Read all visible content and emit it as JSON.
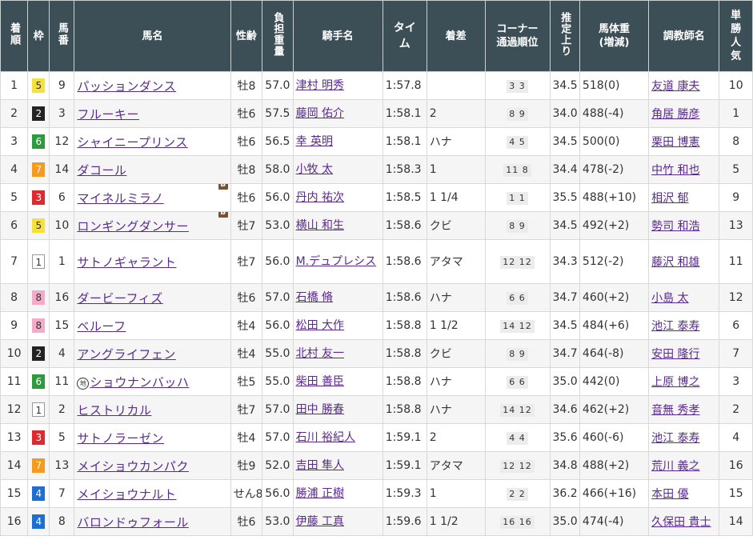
{
  "headers": {
    "rank": "着順",
    "waku": "枠",
    "num": "馬番",
    "horse": "馬名",
    "sexage": "性齢",
    "weight": "負担重量",
    "jockey": "騎手名",
    "time": "タイム",
    "margin": "着差",
    "corner_line1": "コーナー",
    "corner_line2": "通過順位",
    "last3f": "推定上り",
    "body_line1": "馬体重",
    "body_line2": "(増減)",
    "trainer": "調教師名",
    "pop": "単勝人気"
  },
  "colors": {
    "header_bg": "#3c4e56",
    "link": "#5a2a8f",
    "blinkers_badge": "#7a5232"
  },
  "rows": [
    {
      "rank": "1",
      "waku": "5",
      "num": "9",
      "horse": "パッションダンス",
      "b": "",
      "mark": "",
      "sexage": "牡8",
      "weight": "57.0",
      "jockey": "津村 明秀",
      "time": "1:57.8",
      "margin": "",
      "c1": "3",
      "c2": "3",
      "last3f": "34.5",
      "body": "518(0)",
      "trainer": "友道 康夫",
      "pop": "10"
    },
    {
      "rank": "2",
      "waku": "2",
      "num": "3",
      "horse": "フルーキー",
      "b": "",
      "mark": "",
      "sexage": "牡6",
      "weight": "57.5",
      "jockey": "藤岡 佑介",
      "time": "1:58.1",
      "margin": "2",
      "c1": "8",
      "c2": "9",
      "last3f": "34.0",
      "body": "488(-4)",
      "trainer": "角居 勝彦",
      "pop": "1"
    },
    {
      "rank": "3",
      "waku": "6",
      "num": "12",
      "horse": "シャイニープリンス",
      "b": "",
      "mark": "",
      "sexage": "牡6",
      "weight": "56.5",
      "jockey": "幸 英明",
      "time": "1:58.1",
      "margin": "ハナ",
      "c1": "4",
      "c2": "5",
      "last3f": "34.5",
      "body": "500(0)",
      "trainer": "栗田 博憲",
      "pop": "8"
    },
    {
      "rank": "4",
      "waku": "7",
      "num": "14",
      "horse": "ダコール",
      "b": "",
      "mark": "",
      "sexage": "牡8",
      "weight": "58.0",
      "jockey": "小牧 太",
      "time": "1:58.3",
      "margin": "1",
      "c1": "11",
      "c2": "8",
      "last3f": "34.4",
      "body": "478(-2)",
      "trainer": "中竹 和也",
      "pop": "5"
    },
    {
      "rank": "5",
      "waku": "3",
      "num": "6",
      "horse": "マイネルミラノ",
      "b": "B",
      "mark": "",
      "sexage": "牡6",
      "weight": "56.0",
      "jockey": "丹内 祐次",
      "time": "1:58.5",
      "margin": "1 1/4",
      "c1": "1",
      "c2": "1",
      "last3f": "35.5",
      "body": "488(+10)",
      "trainer": "相沢 郁",
      "pop": "9"
    },
    {
      "rank": "6",
      "waku": "5",
      "num": "10",
      "horse": "ロンギングダンサー",
      "b": "B",
      "mark": "",
      "sexage": "牡7",
      "weight": "53.0",
      "jockey": "横山 和生",
      "time": "1:58.6",
      "margin": "クビ",
      "c1": "8",
      "c2": "9",
      "last3f": "34.5",
      "body": "492(+2)",
      "trainer": "勢司 和浩",
      "pop": "13"
    },
    {
      "rank": "7",
      "waku": "1",
      "num": "1",
      "horse": "サトノギャラント",
      "b": "",
      "mark": "",
      "sexage": "牡7",
      "weight": "56.0",
      "jockey": "M.デュプレシス",
      "time": "1:58.6",
      "margin": "アタマ",
      "c1": "12",
      "c2": "12",
      "last3f": "34.3",
      "body": "512(-2)",
      "trainer": "藤沢 和雄",
      "pop": "11"
    },
    {
      "rank": "8",
      "waku": "8",
      "num": "16",
      "horse": "ダービーフィズ",
      "b": "",
      "mark": "",
      "sexage": "牡6",
      "weight": "57.0",
      "jockey": "石橋 脩",
      "time": "1:58.6",
      "margin": "ハナ",
      "c1": "6",
      "c2": "6",
      "last3f": "34.7",
      "body": "460(+2)",
      "trainer": "小島 太",
      "pop": "12"
    },
    {
      "rank": "9",
      "waku": "8",
      "num": "15",
      "horse": "ベルーフ",
      "b": "",
      "mark": "",
      "sexage": "牡4",
      "weight": "56.0",
      "jockey": "松田 大作",
      "time": "1:58.8",
      "margin": "1 1/2",
      "c1": "14",
      "c2": "12",
      "last3f": "34.5",
      "body": "484(+6)",
      "trainer": "池江 泰寿",
      "pop": "6"
    },
    {
      "rank": "10",
      "waku": "2",
      "num": "4",
      "horse": "アングライフェン",
      "b": "",
      "mark": "",
      "sexage": "牡4",
      "weight": "55.0",
      "jockey": "北村 友一",
      "time": "1:58.8",
      "margin": "クビ",
      "c1": "8",
      "c2": "9",
      "last3f": "34.7",
      "body": "464(-8)",
      "trainer": "安田 隆行",
      "pop": "7"
    },
    {
      "rank": "11",
      "waku": "6",
      "num": "11",
      "horse": "ショウナンバッハ",
      "b": "",
      "mark": "地",
      "sexage": "牡5",
      "weight": "55.0",
      "jockey": "柴田 善臣",
      "time": "1:58.8",
      "margin": "ハナ",
      "c1": "6",
      "c2": "6",
      "last3f": "35.0",
      "body": "442(0)",
      "trainer": "上原 博之",
      "pop": "3"
    },
    {
      "rank": "12",
      "waku": "1",
      "num": "2",
      "horse": "ヒストリカル",
      "b": "",
      "mark": "",
      "sexage": "牡7",
      "weight": "57.0",
      "jockey": "田中 勝春",
      "time": "1:58.8",
      "margin": "ハナ",
      "c1": "14",
      "c2": "12",
      "last3f": "34.6",
      "body": "462(+2)",
      "trainer": "音無 秀孝",
      "pop": "2"
    },
    {
      "rank": "13",
      "waku": "3",
      "num": "5",
      "horse": "サトノラーゼン",
      "b": "",
      "mark": "",
      "sexage": "牡4",
      "weight": "57.0",
      "jockey": "石川 裕紀人",
      "time": "1:59.1",
      "margin": "2",
      "c1": "4",
      "c2": "4",
      "last3f": "35.6",
      "body": "460(-6)",
      "trainer": "池江 泰寿",
      "pop": "4"
    },
    {
      "rank": "14",
      "waku": "7",
      "num": "13",
      "horse": "メイショウカンパク",
      "b": "",
      "mark": "",
      "sexage": "牡9",
      "weight": "52.0",
      "jockey": "吉田 隼人",
      "time": "1:59.1",
      "margin": "アタマ",
      "c1": "12",
      "c2": "12",
      "last3f": "34.8",
      "body": "488(+2)",
      "trainer": "荒川 義之",
      "pop": "16"
    },
    {
      "rank": "15",
      "waku": "4",
      "num": "7",
      "horse": "メイショウナルト",
      "b": "",
      "mark": "",
      "sexage": "せん8",
      "weight": "56.0",
      "jockey": "勝浦 正樹",
      "time": "1:59.3",
      "margin": "1",
      "c1": "2",
      "c2": "2",
      "last3f": "36.2",
      "body": "466(+16)",
      "trainer": "本田 優",
      "pop": "15"
    },
    {
      "rank": "16",
      "waku": "4",
      "num": "8",
      "horse": "バロンドゥフォール",
      "b": "",
      "mark": "",
      "sexage": "牡6",
      "weight": "53.0",
      "jockey": "伊藤 工真",
      "time": "1:59.6",
      "margin": "1 1/2",
      "c1": "16",
      "c2": "16",
      "last3f": "35.0",
      "body": "474(-4)",
      "trainer": "久保田 貴士",
      "pop": "14"
    }
  ]
}
